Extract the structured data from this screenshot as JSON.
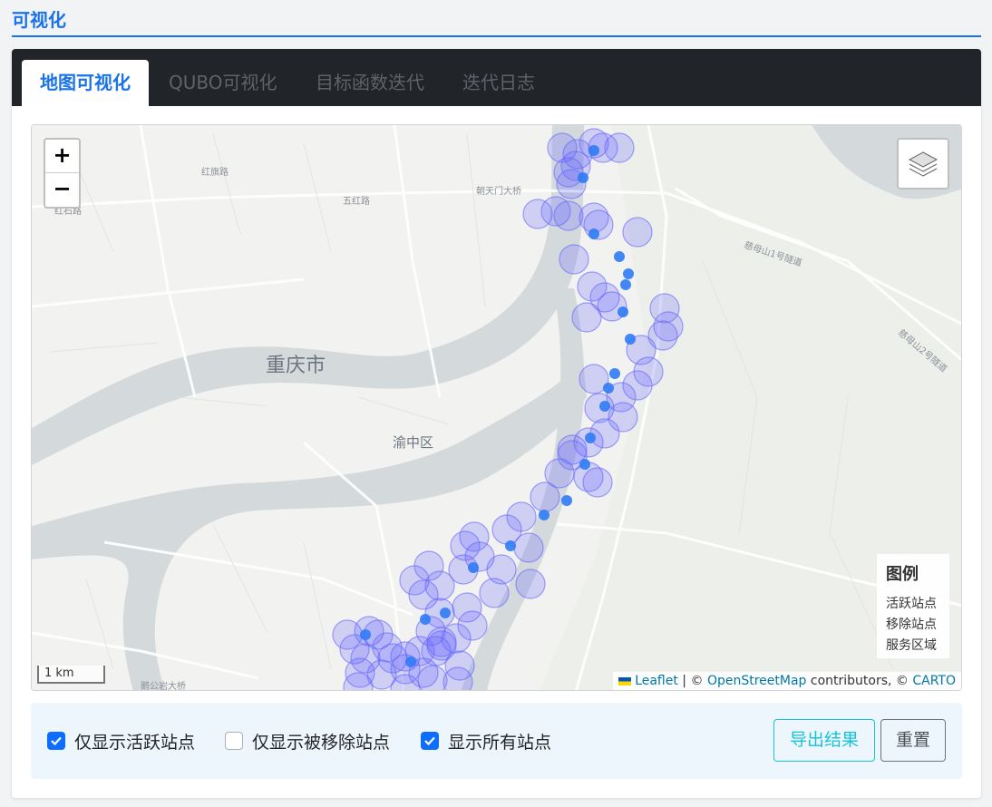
{
  "page": {
    "title": "可视化"
  },
  "tabs": [
    {
      "label": "地图可视化",
      "active": true
    },
    {
      "label": "QUBO可视化",
      "active": false
    },
    {
      "label": "目标函数迭代",
      "active": false
    },
    {
      "label": "迭代日志",
      "active": false
    }
  ],
  "map": {
    "zoom_in": "+",
    "zoom_out": "−",
    "labels": {
      "city": "重庆市",
      "district": "渝中区",
      "road_1": "红旗路",
      "road_2": "五红路",
      "road_3": "朝天门大桥",
      "road_4": "慈母山1号隧道",
      "road_5": "慈母山2号隧道",
      "road_6": "红石路",
      "road_7": "鹅公岩大桥"
    },
    "scale_label": "1 km",
    "attribution": {
      "leaflet": "Leaflet",
      "sep1": " | © ",
      "osm": "OpenStreetMap",
      "mid": " contributors, © ",
      "carto": "CARTO"
    },
    "legend": {
      "title": "图例",
      "items": [
        "活跃站点",
        "移除站点",
        "服务区域"
      ]
    },
    "colors": {
      "service_area": "#6666ff",
      "active_station": "#2f7bf5",
      "water": "#d4dadc",
      "land": "#f2f2f0"
    }
  },
  "filters": [
    {
      "label": "仅显示活跃站点",
      "checked": true
    },
    {
      "label": "仅显示被移除站点",
      "checked": false
    },
    {
      "label": "显示所有站点",
      "checked": true
    }
  ],
  "buttons": {
    "export": "导出结果",
    "reset": "重置"
  }
}
